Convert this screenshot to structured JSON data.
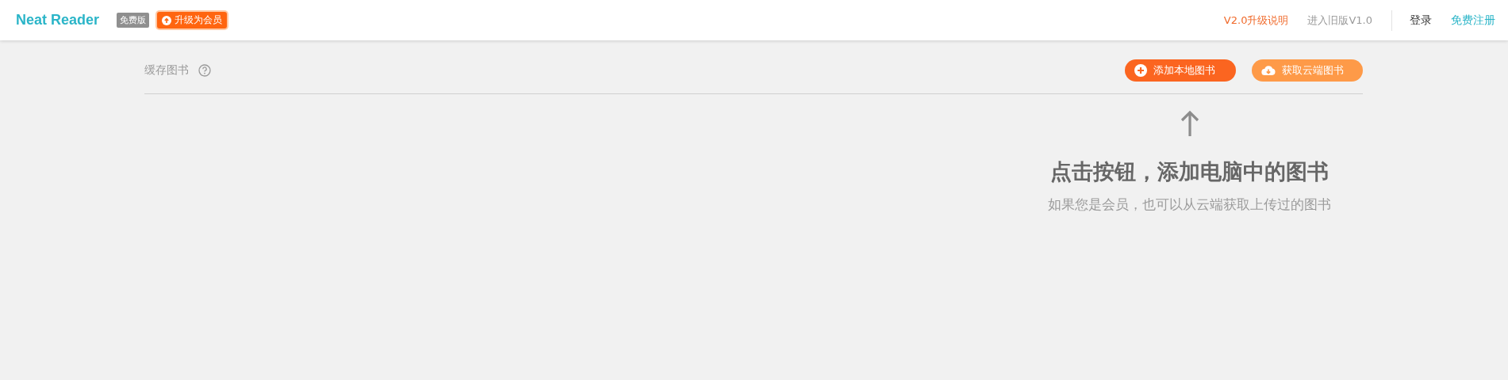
{
  "header": {
    "logo": "Neat Reader",
    "edition_badge": "免费版",
    "upgrade_button": "升级为会员",
    "links": [
      {
        "label": "V2.0升级说明",
        "kind": "accent"
      },
      {
        "label": "进入旧版V1.0",
        "kind": "muted"
      }
    ],
    "login": "登录",
    "register": "免费注册"
  },
  "library": {
    "title": "缓存图书",
    "buttons": [
      {
        "label": "添加本地图书",
        "kind": "add"
      },
      {
        "label": "获取云端图书",
        "kind": "cloud"
      }
    ],
    "empty_state": {
      "title": "点击按钮，添加电脑中的图书",
      "subtitle": "如果您是会员，也可以从云端获取上传过的图书"
    }
  }
}
